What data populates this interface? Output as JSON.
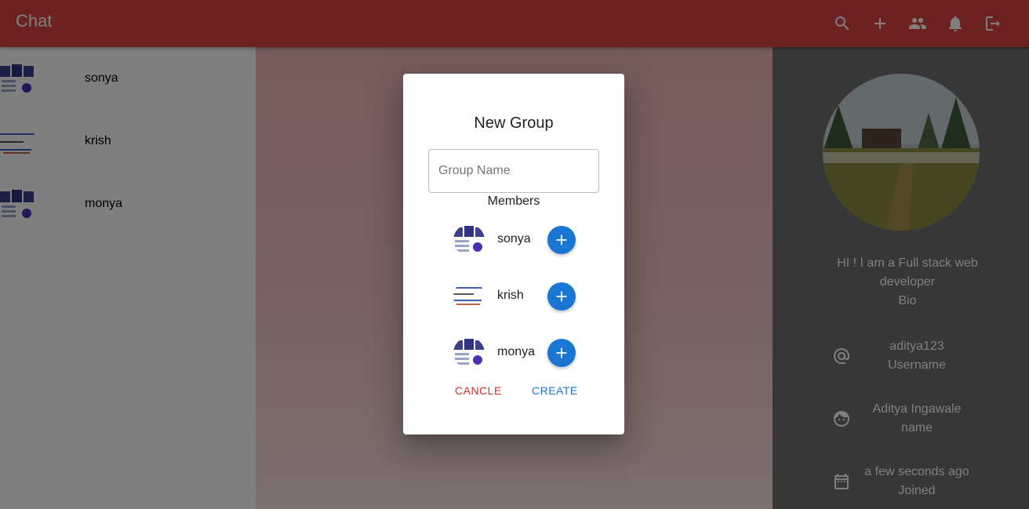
{
  "appbar": {
    "title": "Chat",
    "color": "#db4444",
    "actions": [
      "search-icon",
      "add-icon",
      "people-icon",
      "notifications-icon",
      "logout-icon"
    ]
  },
  "sidebar": {
    "chats": [
      {
        "name": "sonya"
      },
      {
        "name": "krish"
      },
      {
        "name": "monya"
      }
    ]
  },
  "profile": {
    "bio": "HI ! I am a Full stack web developer",
    "bio_label": "Bio",
    "username": "aditya123",
    "username_label": "Username",
    "name": "Aditya Ingawale",
    "name_label": "name",
    "joined": "a few seconds ago",
    "joined_label": "Joined"
  },
  "dialog": {
    "title": "New Group",
    "group_name_placeholder": "Group Name",
    "members_label": "Members",
    "members": [
      {
        "name": "sonya"
      },
      {
        "name": "krish"
      },
      {
        "name": "monya"
      }
    ],
    "cancel_label": "CANCLE",
    "create_label": "CREATE",
    "cancel_color": "#d32f2f",
    "create_color": "#1976d2"
  }
}
